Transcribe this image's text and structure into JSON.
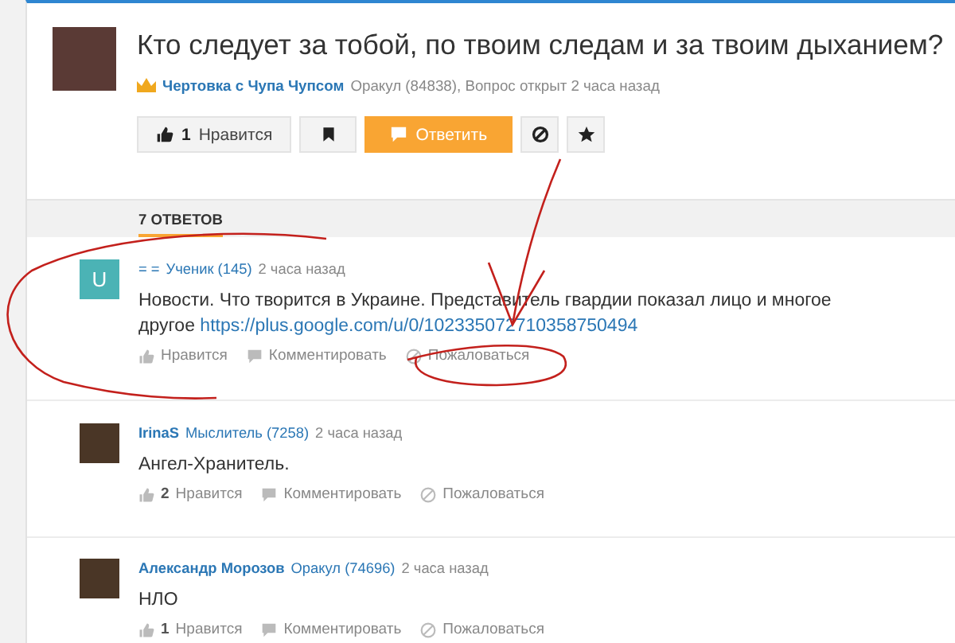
{
  "question": {
    "title": "Кто следует за тобой, по твоим следам и за твоим дыханием?",
    "author": "Чертовка с Чупа Чупсом",
    "meta": "Оракул (84838), Вопрос открыт 2 часа назад",
    "like_count": "1",
    "like_label": "Нравится",
    "reply_label": "Ответить"
  },
  "answers_header": {
    "label": "7 ОТВЕТОВ"
  },
  "answers": [
    {
      "avatar": {
        "kind": "letter",
        "letter": "U"
      },
      "author": "= =",
      "rank": "Ученик (145)",
      "time": "2 часа назад",
      "text": "Новости. Что творится в Украине. Представитель гвардии показал лицо и многое другое",
      "link": "https://plus.google.com/u/0/102335072710358750494",
      "like_label": "Нравится",
      "comment_label": "Комментировать",
      "report_label": "Пожаловаться"
    },
    {
      "avatar": {
        "kind": "photo"
      },
      "author": "IrinaS",
      "rank": "Мыслитель (7258)",
      "time": "2 часа назад",
      "text": "Ангел-Хранитель.",
      "like_count": "2",
      "like_label": "Нравится",
      "comment_label": "Комментировать",
      "report_label": "Пожаловаться"
    },
    {
      "avatar": {
        "kind": "photo"
      },
      "author": "Александр Морозов",
      "rank": "Оракул (74696)",
      "time": "2 часа назад",
      "text": "НЛО",
      "like_count": "1",
      "like_label": "Нравится",
      "comment_label": "Комментировать",
      "report_label": "Пожаловаться"
    }
  ]
}
